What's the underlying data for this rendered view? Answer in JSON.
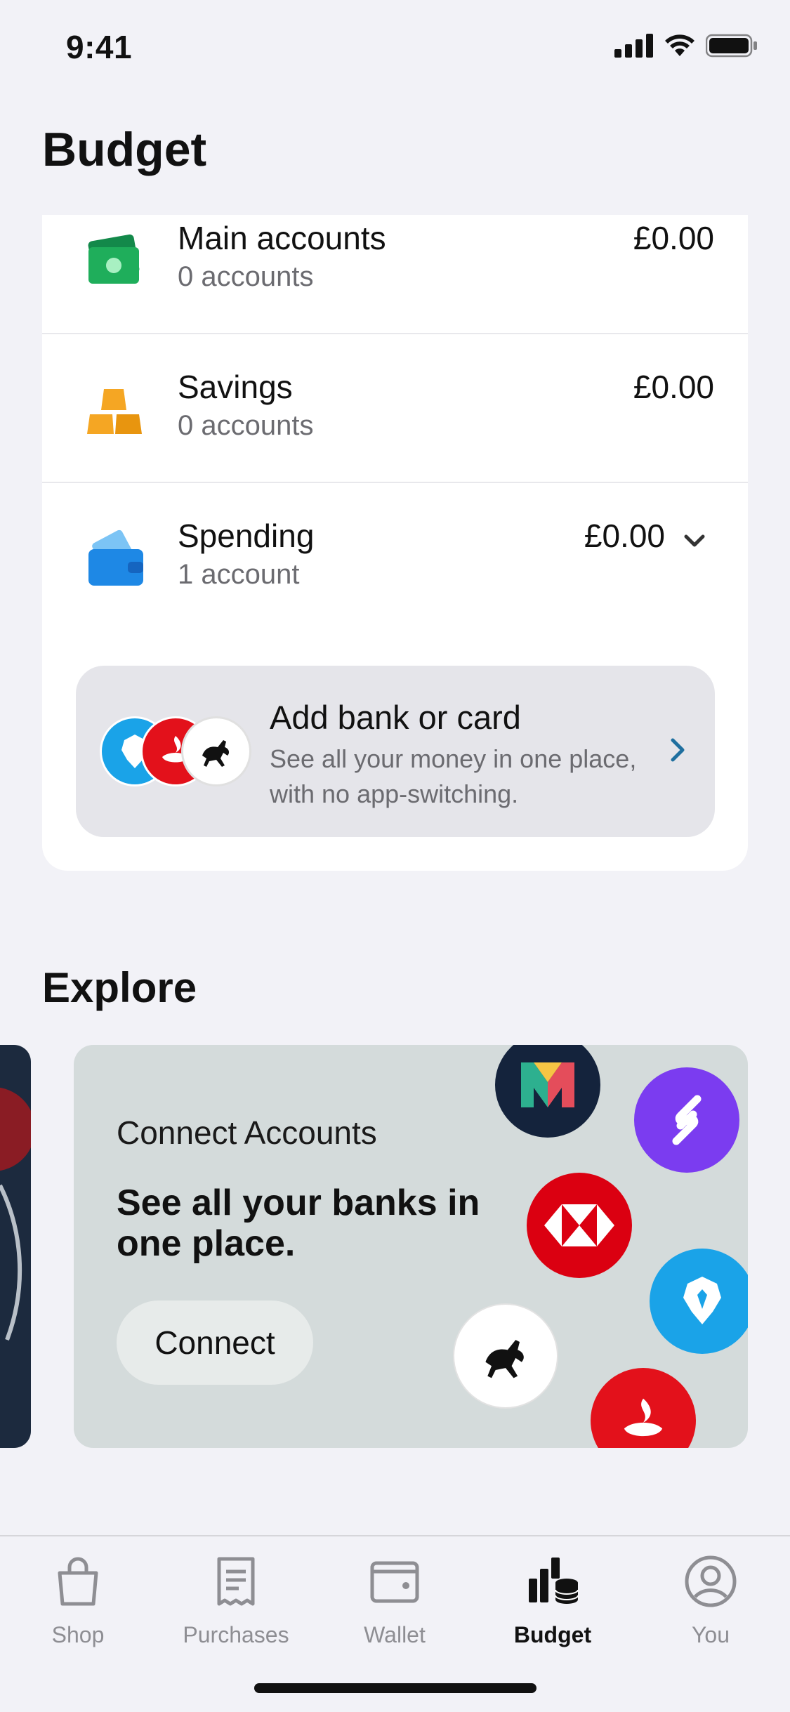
{
  "status_bar": {
    "time": "9:41"
  },
  "page_title": "Budget",
  "accounts": [
    {
      "name": "Main accounts",
      "sub": "0 accounts",
      "amount": "£0.00",
      "icon": "cash-icon"
    },
    {
      "name": "Savings",
      "sub": "0 accounts",
      "amount": "£0.00",
      "icon": "gold-bars-icon"
    },
    {
      "name": "Spending",
      "sub": "1 account",
      "amount": "£0.00",
      "icon": "wallet-icon"
    }
  ],
  "add_bank": {
    "title": "Add bank or card",
    "description": "See all your money in one place, with no app-switching."
  },
  "explore": {
    "title": "Explore",
    "promo": {
      "eyebrow": "Connect Accounts",
      "headline": "See all your banks in one place.",
      "button": "Connect"
    }
  },
  "tabs": [
    {
      "label": "Shop",
      "icon": "shopping-bag-icon",
      "active": false
    },
    {
      "label": "Purchases",
      "icon": "receipt-icon",
      "active": false
    },
    {
      "label": "Wallet",
      "icon": "wallet-icon",
      "active": false
    },
    {
      "label": "Budget",
      "icon": "budget-icon",
      "active": true
    },
    {
      "label": "You",
      "icon": "profile-icon",
      "active": false
    }
  ],
  "colors": {
    "background": "#f2f2f7",
    "cash_green": "#1fae5b",
    "gold": "#f5a623",
    "wallet_blue": "#1e88e5",
    "barclays_blue": "#1aa3e8",
    "santander_red": "#e3111b",
    "hsbc_red": "#db0011",
    "starling_purple": "#7b3cf0",
    "monzo_navy": "#14233c"
  }
}
